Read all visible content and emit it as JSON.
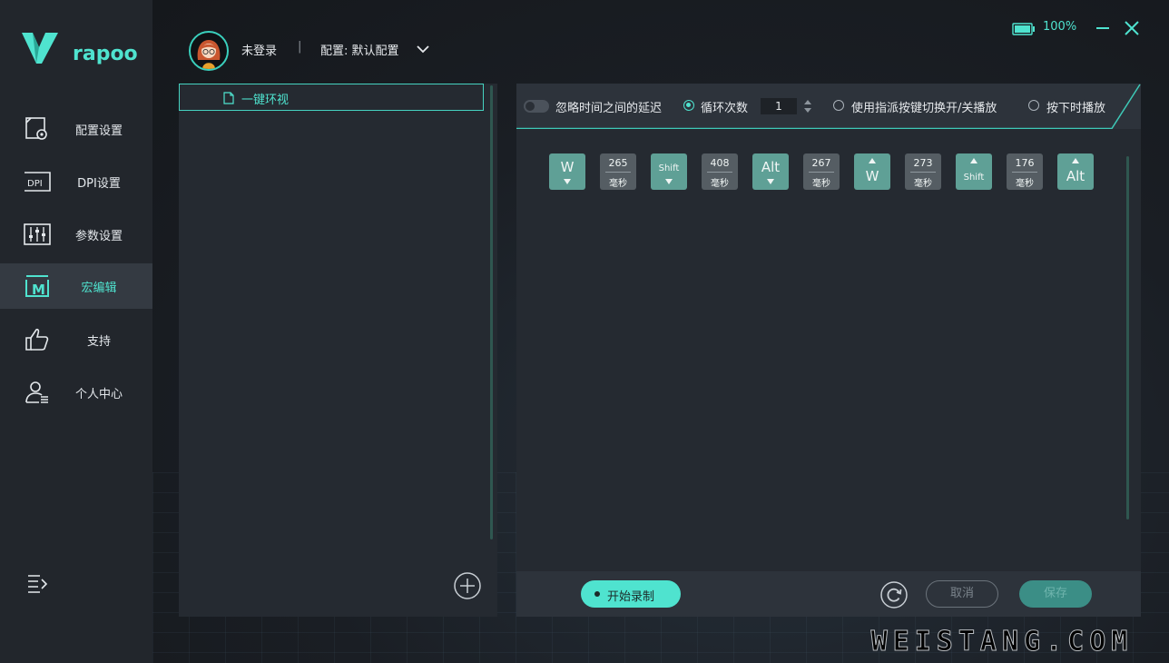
{
  "app": {
    "logo_text": "rapoo",
    "accent": "#4fe3cf"
  },
  "sidebar": {
    "items": [
      {
        "label": "配置设置",
        "icon": "profile-settings-icon",
        "active": false
      },
      {
        "label": "DPI设置",
        "icon": "dpi-icon",
        "active": false,
        "icon_text": "DPI"
      },
      {
        "label": "参数设置",
        "icon": "sliders-icon",
        "active": false
      },
      {
        "label": "宏编辑",
        "icon": "macro-icon",
        "active": true,
        "icon_text": "M"
      },
      {
        "label": "支持",
        "icon": "thumbs-up-icon",
        "active": false
      },
      {
        "label": "个人中心",
        "icon": "user-center-icon",
        "active": false
      }
    ],
    "collapse_icon": "menu-collapse-icon"
  },
  "header": {
    "user_name": "未登录",
    "separator": "|",
    "config_label": "配置: 默认配置",
    "battery_text": "100%"
  },
  "macro_list": {
    "items": [
      {
        "name": "一键环视",
        "selected": true
      }
    ]
  },
  "toolbar": {
    "ignore_delay_label": "忽略时间之间的延迟",
    "ignore_delay_on": false,
    "loop_label": "循环次数",
    "loop_count": "1",
    "toggle_play_label": "使用指派按键切换开/关播放",
    "hold_play_label": "按下时播放",
    "selected_mode": "loop"
  },
  "actions": [
    {
      "type": "key",
      "key": "W",
      "dir": "down"
    },
    {
      "type": "delay",
      "value": "265",
      "unit": "毫秒"
    },
    {
      "type": "key",
      "key": "Shift",
      "dir": "down"
    },
    {
      "type": "delay",
      "value": "408",
      "unit": "毫秒"
    },
    {
      "type": "key",
      "key": "Alt",
      "dir": "down"
    },
    {
      "type": "delay",
      "value": "267",
      "unit": "毫秒"
    },
    {
      "type": "key",
      "key": "W",
      "dir": "up"
    },
    {
      "type": "delay",
      "value": "273",
      "unit": "毫秒"
    },
    {
      "type": "key",
      "key": "Shift",
      "dir": "up"
    },
    {
      "type": "delay",
      "value": "176",
      "unit": "毫秒"
    },
    {
      "type": "key",
      "key": "Alt",
      "dir": "up"
    }
  ],
  "bottom": {
    "record_label": "开始录制",
    "cancel_label": "取消",
    "save_label": "保存"
  },
  "watermark": "WEISTANG.COM"
}
